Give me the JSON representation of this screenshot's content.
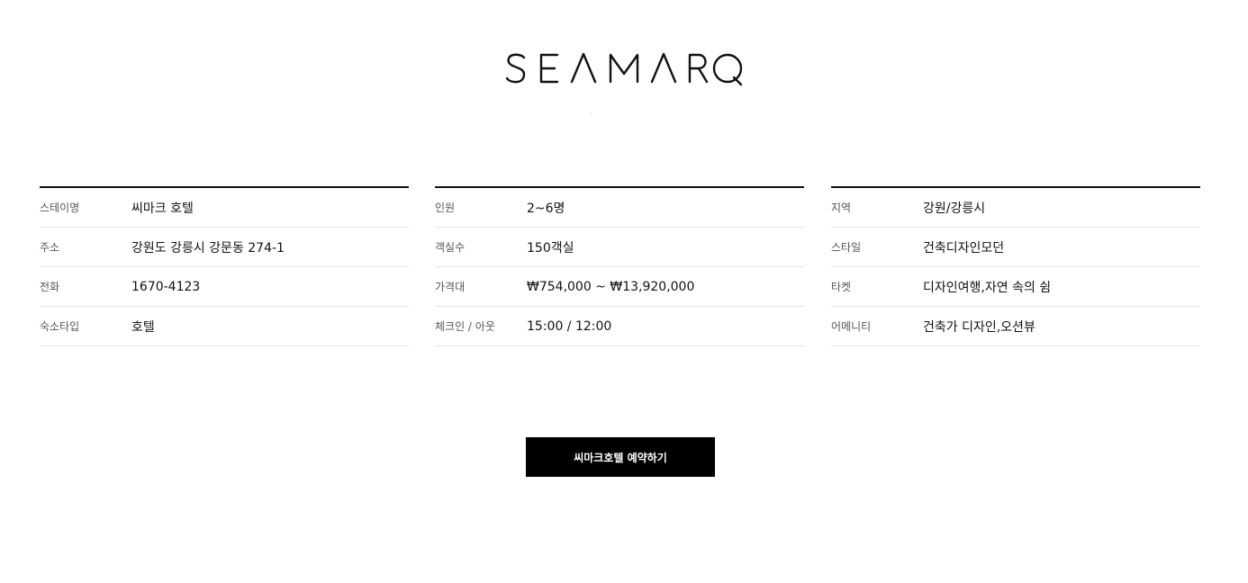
{
  "brand": {
    "logo_text": "SEAMARQ"
  },
  "info": {
    "columns": [
      {
        "rows": [
          {
            "label": "스테이명",
            "value": "씨마크 호텔"
          },
          {
            "label": "주소",
            "value": "강원도 강릉시 강문동 274-1"
          },
          {
            "label": "전화",
            "value": "1670-4123"
          },
          {
            "label": "숙소타입",
            "value": "호텔"
          }
        ]
      },
      {
        "rows": [
          {
            "label": "인원",
            "value": "2~6명"
          },
          {
            "label": "객실수",
            "value": "150객실"
          },
          {
            "label": "가격대",
            "value": "₩754,000 ~ ₩13,920,000"
          },
          {
            "label": "체크인 / 아웃",
            "value": "15:00 / 12:00"
          }
        ]
      },
      {
        "rows": [
          {
            "label": "지역",
            "value": "강원/강릉시"
          },
          {
            "label": "스타일",
            "value": "건축디자인모던"
          },
          {
            "label": "타켓",
            "value": "디자인여행,자연 속의 쉼"
          },
          {
            "label": "어메니티",
            "value": "건축가 디자인,오션뷰"
          }
        ]
      }
    ]
  },
  "cta": {
    "book_label": "씨마크호텔 예약하기"
  },
  "colors": {
    "text": "#111111",
    "button_bg": "#000000",
    "button_text": "#ffffff",
    "divider": "#e6e6e6"
  }
}
